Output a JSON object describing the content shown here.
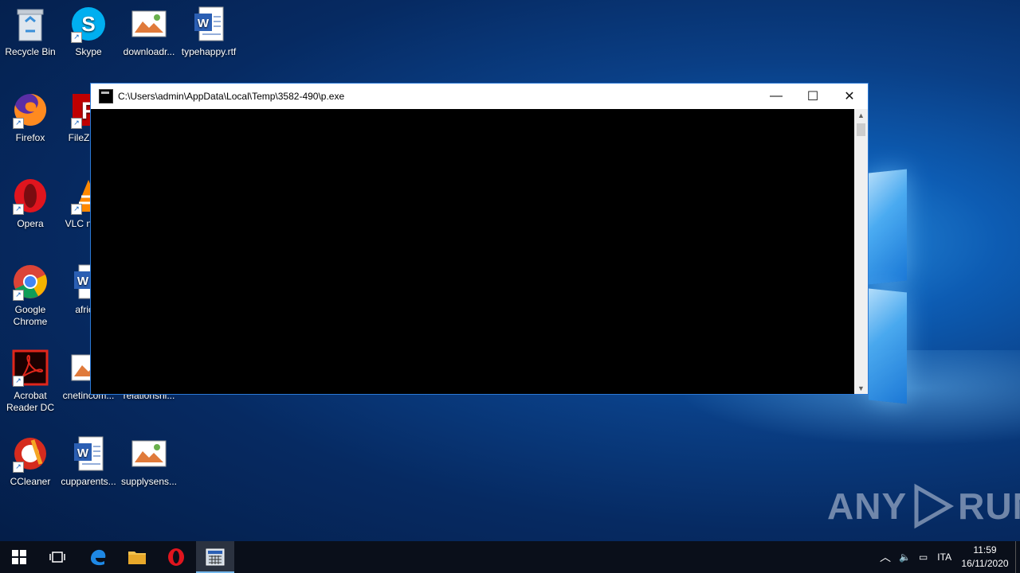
{
  "desktop": {
    "icons": [
      {
        "label": "Recycle Bin",
        "icon": "recycle-bin-icon"
      },
      {
        "label": "Skype",
        "icon": "skype-icon"
      },
      {
        "label": "downloadr...",
        "icon": "image-file-icon"
      },
      {
        "label": "typehappy.rtf",
        "icon": "word-document-icon"
      },
      {
        "label": "Firefox",
        "icon": "firefox-icon"
      },
      {
        "label": "FileZ Clie",
        "icon": "filezilla-icon"
      },
      {
        "label": "Opera",
        "icon": "opera-icon"
      },
      {
        "label": "VLC n play",
        "icon": "vlc-icon"
      },
      {
        "label": "Google Chrome",
        "icon": "chrome-icon"
      },
      {
        "label": "africar",
        "icon": "word-document-icon"
      },
      {
        "label": "Acrobat Reader DC",
        "icon": "acrobat-icon"
      },
      {
        "label": "cnetincom...",
        "icon": "image-file-icon"
      },
      {
        "label": "relationshi...",
        "icon": "image-file-icon"
      },
      {
        "label": "CCleaner",
        "icon": "ccleaner-icon"
      },
      {
        "label": "cupparents...",
        "icon": "word-document-icon"
      },
      {
        "label": "supplysens...",
        "icon": "image-file-icon"
      }
    ]
  },
  "window": {
    "title": "C:\\Users\\admin\\AppData\\Local\\Temp\\3582-490\\p.exe",
    "minimize": "—",
    "maximize": "☐",
    "close": "✕"
  },
  "taskbar": {
    "language": "ITA",
    "time": "11:59",
    "date": "16/11/2020"
  },
  "watermark": {
    "left": "ANY",
    "right": "RUN"
  },
  "colors": {
    "accent": "#2b79d6",
    "taskbar": "#0a0f1a",
    "console": "#000000"
  }
}
